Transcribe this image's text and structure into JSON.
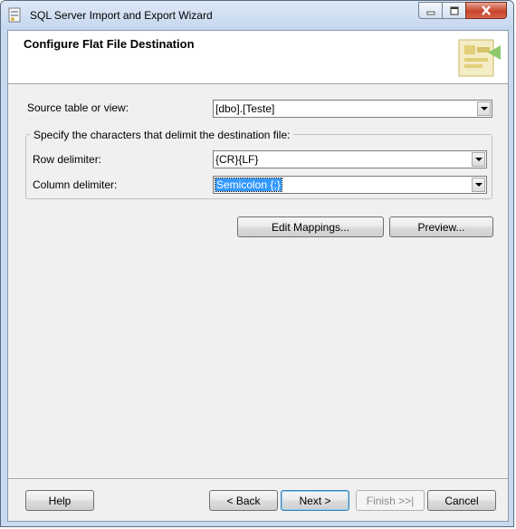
{
  "window": {
    "title": "SQL Server Import and Export Wizard"
  },
  "header": {
    "title": "Configure Flat File Destination"
  },
  "form": {
    "source_label": "Source table or view:",
    "source_value": "[dbo].[Teste]",
    "group_legend": "Specify the characters that delimit the destination file:",
    "row_label": "Row delimiter:",
    "row_value": "{CR}{LF}",
    "column_label": "Column delimiter:",
    "column_value": "Semicolon {;}"
  },
  "actions": {
    "edit_mappings": "Edit Mappings...",
    "preview": "Preview..."
  },
  "footer": {
    "help": "Help",
    "back": "< Back",
    "next": "Next >",
    "finish": "Finish >>|",
    "cancel": "Cancel"
  },
  "colors": {
    "selection": "#3399ff",
    "titlebar": "#c4d6ee",
    "close_button": "#c7452c"
  }
}
